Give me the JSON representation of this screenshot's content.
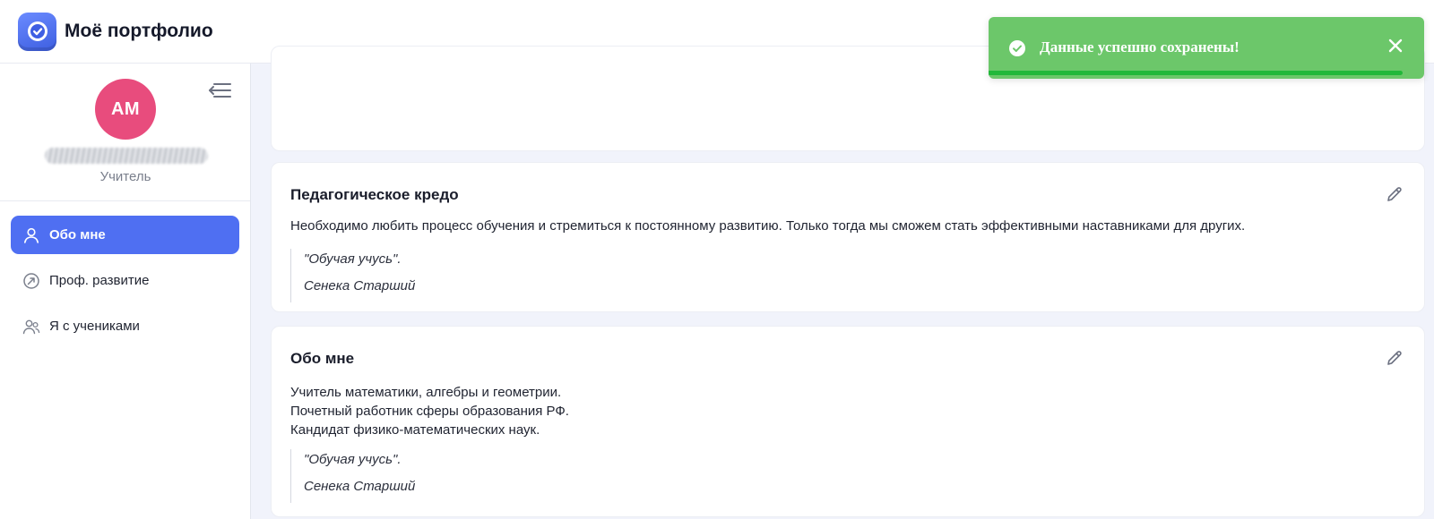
{
  "app": {
    "title": "Моё портфолио"
  },
  "profile": {
    "initials": "АМ",
    "role": "Учитель"
  },
  "nav": [
    {
      "label": "Обо мне",
      "icon": "user-icon",
      "active": true
    },
    {
      "label": "Проф. развитие",
      "icon": "growth-arrow-icon",
      "active": false
    },
    {
      "label": "Я с учениками",
      "icon": "users-icon",
      "active": false
    }
  ],
  "credo": {
    "title": "Педагогическое кредо",
    "text": "Необходимо любить процесс обучения и стремиться к постоянному развитию. Только тогда мы сможем стать эффективными наставниками для других.",
    "quote": "\"Обучая учусь\".",
    "author": "Сенека Старший"
  },
  "about": {
    "title": "Обо мне",
    "lines": [
      "Учитель математики, алгебры и геометрии.",
      "Почетный работник сферы образования РФ.",
      "Кандидат физико-математических наук."
    ],
    "quote": "\"Обучая учусь\".",
    "author": "Сенека Старший"
  },
  "toast": {
    "message": "Данные успешно сохранены!",
    "progress_percent": 95,
    "color": "#6cc76a"
  },
  "colors": {
    "accent": "#4f6ff2",
    "avatar": "#e84c7d",
    "toast_bar": "#22b83a"
  }
}
